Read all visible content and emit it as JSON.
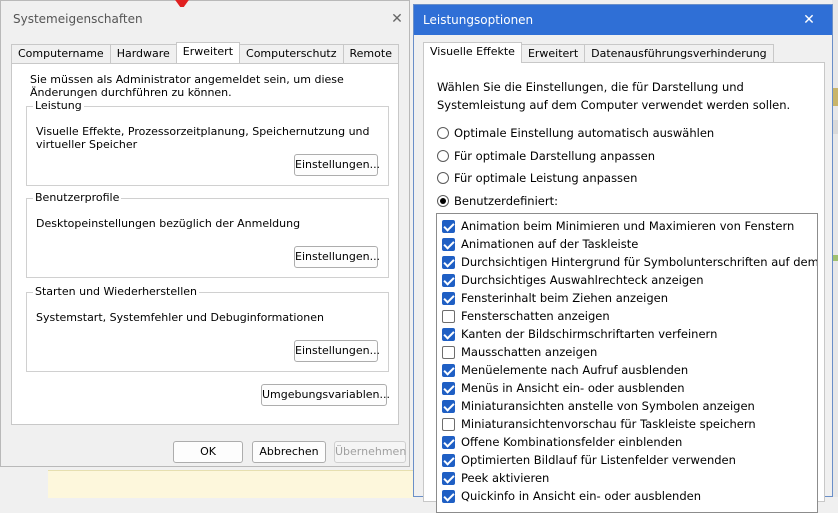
{
  "left_dialog": {
    "title": "Systemeigenschaften",
    "close_glyph": "✕",
    "tabs": [
      {
        "label": "Computername",
        "active": false
      },
      {
        "label": "Hardware",
        "active": false
      },
      {
        "label": "Erweitert",
        "active": true
      },
      {
        "label": "Computerschutz",
        "active": false
      },
      {
        "label": "Remote",
        "active": false
      }
    ],
    "admin_note": "Sie müssen als Administrator angemeldet sein, um diese Änderungen durchführen zu können.",
    "groups": {
      "performance": {
        "legend": "Leistung",
        "description": "Visuelle Effekte, Prozessorzeitplanung, Speichernutzung und virtueller Speicher",
        "button": "Einstellungen..."
      },
      "profiles": {
        "legend": "Benutzerprofile",
        "description": "Desktopeinstellungen bezüglich der Anmeldung",
        "button": "Einstellungen..."
      },
      "startup": {
        "legend": "Starten und Wiederherstellen",
        "description": "Systemstart, Systemfehler und Debuginformationen",
        "button": "Einstellungen..."
      }
    },
    "env_button": "Umgebungsvariablen...",
    "footer": {
      "ok": "OK",
      "cancel": "Abbrechen",
      "apply": "Übernehmen"
    }
  },
  "right_dialog": {
    "title": "Leistungsoptionen",
    "close_glyph": "✕",
    "tabs": [
      {
        "label": "Visuelle Effekte",
        "active": true
      },
      {
        "label": "Erweitert",
        "active": false
      },
      {
        "label": "Datenausführungsverhinderung",
        "active": false
      }
    ],
    "intro": "Wählen Sie die Einstellungen, die für Darstellung und Systemleistung auf dem Computer verwendet werden sollen.",
    "radios": [
      {
        "label": "Optimale Einstellung automatisch auswählen",
        "selected": false
      },
      {
        "label": "Für optimale Darstellung anpassen",
        "selected": false
      },
      {
        "label": "Für optimale Leistung anpassen",
        "selected": false
      },
      {
        "label": "Benutzerdefiniert:",
        "selected": true
      }
    ],
    "effects": [
      {
        "label": "Animation beim Minimieren und Maximieren von Fenstern",
        "checked": true
      },
      {
        "label": "Animationen auf der Taskleiste",
        "checked": true
      },
      {
        "label": "Durchsichtigen Hintergrund für Symbolunterschriften auf dem De",
        "checked": true
      },
      {
        "label": "Durchsichtiges Auswahlrechteck anzeigen",
        "checked": true
      },
      {
        "label": "Fensterinhalt beim Ziehen anzeigen",
        "checked": true
      },
      {
        "label": "Fensterschatten anzeigen",
        "checked": false,
        "highlighted": true
      },
      {
        "label": "Kanten der Bildschirmschriftarten verfeinern",
        "checked": true
      },
      {
        "label": "Mausschatten anzeigen",
        "checked": false
      },
      {
        "label": "Menüelemente nach Aufruf ausblenden",
        "checked": true
      },
      {
        "label": "Menüs in Ansicht ein- oder ausblenden",
        "checked": true
      },
      {
        "label": "Miniaturansichten anstelle von Symbolen anzeigen",
        "checked": true
      },
      {
        "label": "Miniaturansichtenvorschau für Taskleiste speichern",
        "checked": false
      },
      {
        "label": "Offene Kombinationsfelder einblenden",
        "checked": true
      },
      {
        "label": "Optimierten Bildlauf für Listenfelder verwenden",
        "checked": true
      },
      {
        "label": "Peek aktivieren",
        "checked": true
      },
      {
        "label": "Quickinfo in Ansicht ein- oder ausblenden",
        "checked": true
      }
    ],
    "colors": {
      "titlebar": "#2f6fd6",
      "checkbox": "#1f5fc4",
      "annotation": "#d9262e"
    }
  }
}
